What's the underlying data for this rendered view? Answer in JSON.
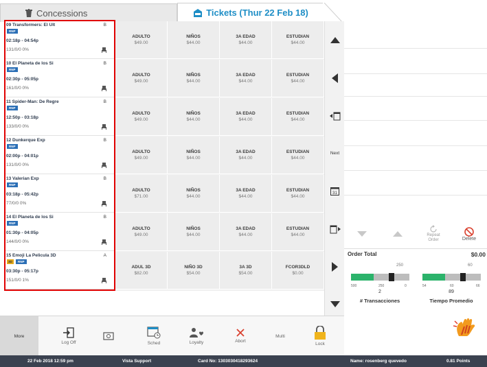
{
  "tabs": {
    "concessions": "Concessions",
    "tickets": "Tickets (Thur 22 Feb 18)"
  },
  "sessions": [
    {
      "title": "09 Transformers: El Ult",
      "rating": "B",
      "badge": "RNP",
      "time": "02:18p - 04:54p",
      "seats": "131/0/0  0%"
    },
    {
      "title": "10 El Planeta de los Si",
      "rating": "B",
      "badge": "RNP",
      "time": "02:30p - 05:05p",
      "seats": "161/0/0  0%"
    },
    {
      "title": "11 Spider-Man: De Regre",
      "rating": "B",
      "badge": "RNP",
      "time": "12:50p - 03:18p",
      "seats": "133/0/0  0%"
    },
    {
      "title": "12 Dunkerque Exp",
      "rating": "B",
      "badge": "RNP",
      "time": "02:00p - 04:01p",
      "seats": "131/0/0  0%"
    },
    {
      "title": "13 Valerian Exp",
      "rating": "B",
      "badge": "RNP",
      "time": "03:18p - 05:42p",
      "seats": "77/0/0  0%"
    },
    {
      "title": "14 El Planeta de los Si",
      "rating": "B",
      "badge": "RNP",
      "time": "01:30p - 04:05p",
      "seats": "144/0/0  0%"
    },
    {
      "title": "15 Emoji La Pelicula 3D",
      "rating": "A",
      "badge": "RNP",
      "badge3d": "3D",
      "time": "03:30p - 05:17p",
      "seats": "151/0/0  1%"
    }
  ],
  "ticket_rows": [
    [
      {
        "name": "ADULTO",
        "price": "$49.00"
      },
      {
        "name": "NIÑOS",
        "price": "$44.00"
      },
      {
        "name": "3A EDAD",
        "price": "$44.00"
      },
      {
        "name": "ESTUDIAN",
        "price": "$44.00"
      }
    ],
    [
      {
        "name": "ADULTO",
        "price": "$49.00"
      },
      {
        "name": "NIÑOS",
        "price": "$44.00"
      },
      {
        "name": "3A EDAD",
        "price": "$44.00"
      },
      {
        "name": "ESTUDIAN",
        "price": "$44.00"
      }
    ],
    [
      {
        "name": "ADULTO",
        "price": "$49.00"
      },
      {
        "name": "NIÑOS",
        "price": "$44.00"
      },
      {
        "name": "3A EDAD",
        "price": "$44.00"
      },
      {
        "name": "ESTUDIAN",
        "price": "$44.00"
      }
    ],
    [
      {
        "name": "ADULTO",
        "price": "$49.00"
      },
      {
        "name": "NIÑOS",
        "price": "$44.00"
      },
      {
        "name": "3A EDAD",
        "price": "$44.00"
      },
      {
        "name": "ESTUDIAN",
        "price": "$44.00"
      }
    ],
    [
      {
        "name": "ADULTO",
        "price": "$71.00"
      },
      {
        "name": "NIÑOS",
        "price": "$44.00"
      },
      {
        "name": "3A EDAD",
        "price": "$44.00"
      },
      {
        "name": "ESTUDIAN",
        "price": "$44.00"
      }
    ],
    [
      {
        "name": "ADULTO",
        "price": "$49.00"
      },
      {
        "name": "NIÑOS",
        "price": "$44.00"
      },
      {
        "name": "3A EDAD",
        "price": "$44.00"
      },
      {
        "name": "ESTUDIAN",
        "price": "$44.00"
      }
    ],
    [
      {
        "name": "ADUL 3D",
        "price": "$82.00"
      },
      {
        "name": "NIÑO 3D",
        "price": "$54.00"
      },
      {
        "name": "3A 3D",
        "price": "$54.00"
      },
      {
        "name": "FCOR3DLD",
        "price": "$0.00"
      }
    ]
  ],
  "nav": {
    "next_label": "Next",
    "calendar_day": "31"
  },
  "order": {
    "repeat_label": "Repeat Order",
    "delete_label": "Delete",
    "total_label": "Order Total",
    "total_value": "$0.00"
  },
  "gauges": [
    {
      "top": "250",
      "scale_left": "500",
      "scale_mid": "250",
      "scale_right": "0",
      "value": "2",
      "label": "# Transacciones",
      "fill": 0.62
    },
    {
      "top": "60",
      "scale_left": "54",
      "scale_mid": "60",
      "scale_right": "66",
      "value": "89",
      "label": "Tiempo Promedio",
      "fill": 0.62
    }
  ],
  "toolbar": {
    "more": "More",
    "logoff": "Log Off",
    "sched": "Sched",
    "loyalty": "Loyalty",
    "abort": "Abort",
    "multi": "Multi",
    "lock": "Lock"
  },
  "status": {
    "datetime": "22 Feb 2018 12:59 pm",
    "support": "Vista Support",
    "card": "Card No: 1303030418293624",
    "name": "Name: rosenberg quevedo",
    "points": "0.81 Points"
  },
  "colors": {
    "accent": "#1e8ec6",
    "badge": "#2b6fb6",
    "gauge_green": "#2bb36b",
    "delete_red": "#d9412f",
    "status_bar": "#3b4250"
  }
}
